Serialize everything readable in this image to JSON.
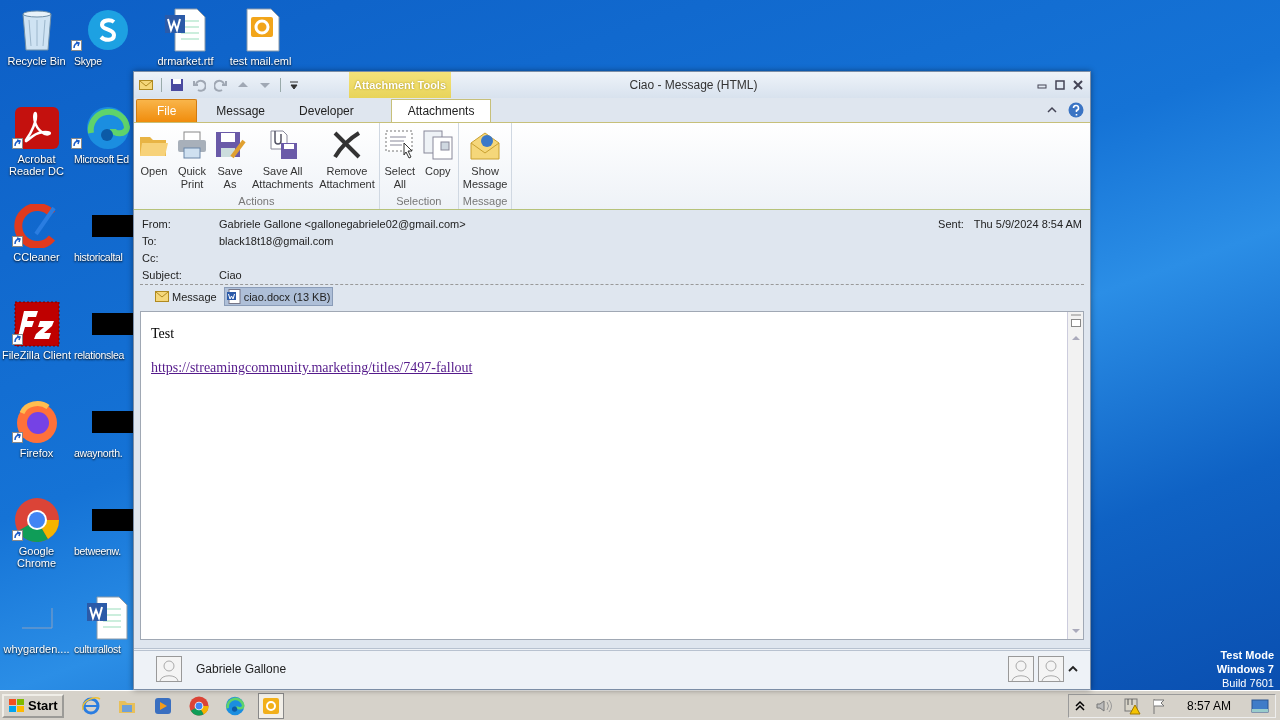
{
  "desktop": {
    "columns": [
      [
        {
          "label": "Recycle Bin",
          "kind": "recycle",
          "shortcut": false
        },
        {
          "label": "Acrobat Reader DC",
          "kind": "acrobat",
          "shortcut": true
        },
        {
          "label": "CCleaner",
          "kind": "ccleaner",
          "shortcut": true
        },
        {
          "label": "FileZilla Client",
          "kind": "filezilla",
          "shortcut": true
        },
        {
          "label": "Firefox",
          "kind": "firefox",
          "shortcut": true
        },
        {
          "label": "Google Chrome",
          "kind": "chrome",
          "shortcut": true
        },
        {
          "label": "whygarden....",
          "kind": "blank",
          "shortcut": false
        }
      ],
      [
        {
          "label": "Skype",
          "kind": "skype",
          "shortcut": true
        },
        {
          "label": "Microsoft Ed",
          "kind": "edge",
          "shortcut": true
        },
        {
          "label": "historicaltal",
          "kind": "redacted",
          "shortcut": false
        },
        {
          "label": "relationslea",
          "kind": "redacted",
          "shortcut": false
        },
        {
          "label": "awaynorth.",
          "kind": "redacted",
          "shortcut": false
        },
        {
          "label": "betweenw.",
          "kind": "redacted",
          "shortcut": false
        },
        {
          "label": "culturallost",
          "kind": "word",
          "shortcut": false
        }
      ],
      [
        {
          "label": "drmarket.rtf",
          "kind": "word",
          "shortcut": false
        }
      ],
      [
        {
          "label": "test mail.eml",
          "kind": "outlook",
          "shortcut": false
        }
      ]
    ],
    "notice": [
      "Test Mode",
      "Windows 7",
      "Build 7601"
    ]
  },
  "window": {
    "title": "Ciao - Message (HTML)",
    "context_tab": "Attachment Tools",
    "tabs": [
      {
        "label": "File",
        "kind": "file",
        "selected": false
      },
      {
        "label": "Message",
        "kind": "tab",
        "selected": false
      },
      {
        "label": "Developer",
        "kind": "tab",
        "selected": false
      },
      {
        "label": "Attachments",
        "kind": "tab",
        "selected": true
      }
    ],
    "groups": [
      {
        "label": "Actions",
        "buttons": [
          {
            "label": "Open",
            "kind": "open"
          },
          {
            "label": "Quick Print",
            "kind": "print"
          },
          {
            "label": "Save As",
            "kind": "saveas"
          },
          {
            "label": "Save All Attachments",
            "kind": "saveall"
          },
          {
            "label": "Remove Attachment",
            "kind": "remove"
          }
        ]
      },
      {
        "label": "Selection",
        "buttons": [
          {
            "label": "Select All",
            "kind": "selectall"
          },
          {
            "label": "Copy",
            "kind": "copy"
          }
        ]
      },
      {
        "label": "Message",
        "buttons": [
          {
            "label": "Show Message",
            "kind": "show"
          }
        ]
      }
    ],
    "fields": [
      {
        "label": "From:",
        "value": "Gabriele Gallone <gallonegabriele02@gmail.com>"
      },
      {
        "label": "To:",
        "value": "black18t18@gmail.com"
      },
      {
        "label": "Cc:"
      },
      {
        "label": "Subject:",
        "value": "Ciao"
      }
    ],
    "sent": {
      "label": "Sent:",
      "value": "Thu 5/9/2024 8:54 AM"
    },
    "attachments": [
      {
        "label": "Message",
        "kind": "message",
        "selected": false
      },
      {
        "label": "ciao.docx (13 KB)",
        "kind": "file",
        "selected": true
      }
    ],
    "body": [
      {
        "kind": "text",
        "text": "Test"
      },
      {
        "kind": "link",
        "text": "https://streamingcommunity.marketing/titles/7497-fallout"
      }
    ],
    "people": {
      "name": "Gabriele Gallone"
    }
  },
  "taskbar": {
    "start": "Start",
    "apps": [
      {
        "kind": "ie",
        "active": false
      },
      {
        "kind": "folder",
        "active": false
      },
      {
        "kind": "media",
        "active": false
      },
      {
        "kind": "chrome",
        "active": false
      },
      {
        "kind": "edge",
        "active": false
      },
      {
        "kind": "outlook",
        "active": true
      }
    ],
    "clock": "8:57 AM"
  }
}
